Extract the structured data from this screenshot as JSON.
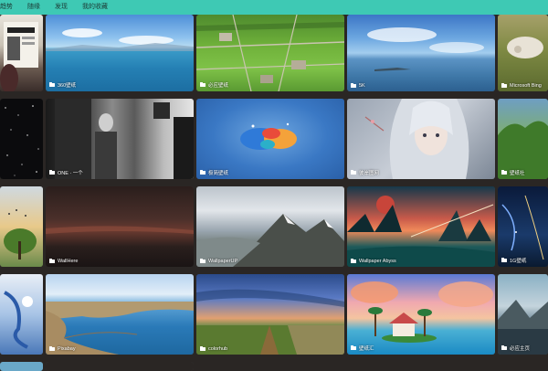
{
  "nav": {
    "items": [
      {
        "label": "趋势"
      },
      {
        "label": "随缘"
      },
      {
        "label": "发现"
      },
      {
        "label": "我的收藏"
      }
    ]
  },
  "tiles": {
    "r0c1": {
      "label": "360壁纸"
    },
    "r0c2": {
      "label": "必应壁纸"
    },
    "r0c3": {
      "label": "5K"
    },
    "r0c4": {
      "label": "Microsoft Bing"
    },
    "r1c1": {
      "label": "ONE · 一个"
    },
    "r1c2": {
      "label": "极简壁纸"
    },
    "r1c3": {
      "label": "彼岸图网"
    },
    "r1c4": {
      "label": "壁纸社"
    },
    "r2c1": {
      "label": "WallHere"
    },
    "r2c2": {
      "label": "WallpaperUP"
    },
    "r2c3": {
      "label": "Wallpaper Abyss"
    },
    "r2c4": {
      "label": "1G壁纸"
    },
    "r3c1": {
      "label": "Pixabay"
    },
    "r3c2": {
      "label": "colorhub"
    },
    "r3c3": {
      "label": "壁纸汇"
    },
    "r3c4": {
      "label": "必应主页"
    }
  },
  "colors": {
    "topbar": "#3ec9b4",
    "background": "#2a2624"
  }
}
